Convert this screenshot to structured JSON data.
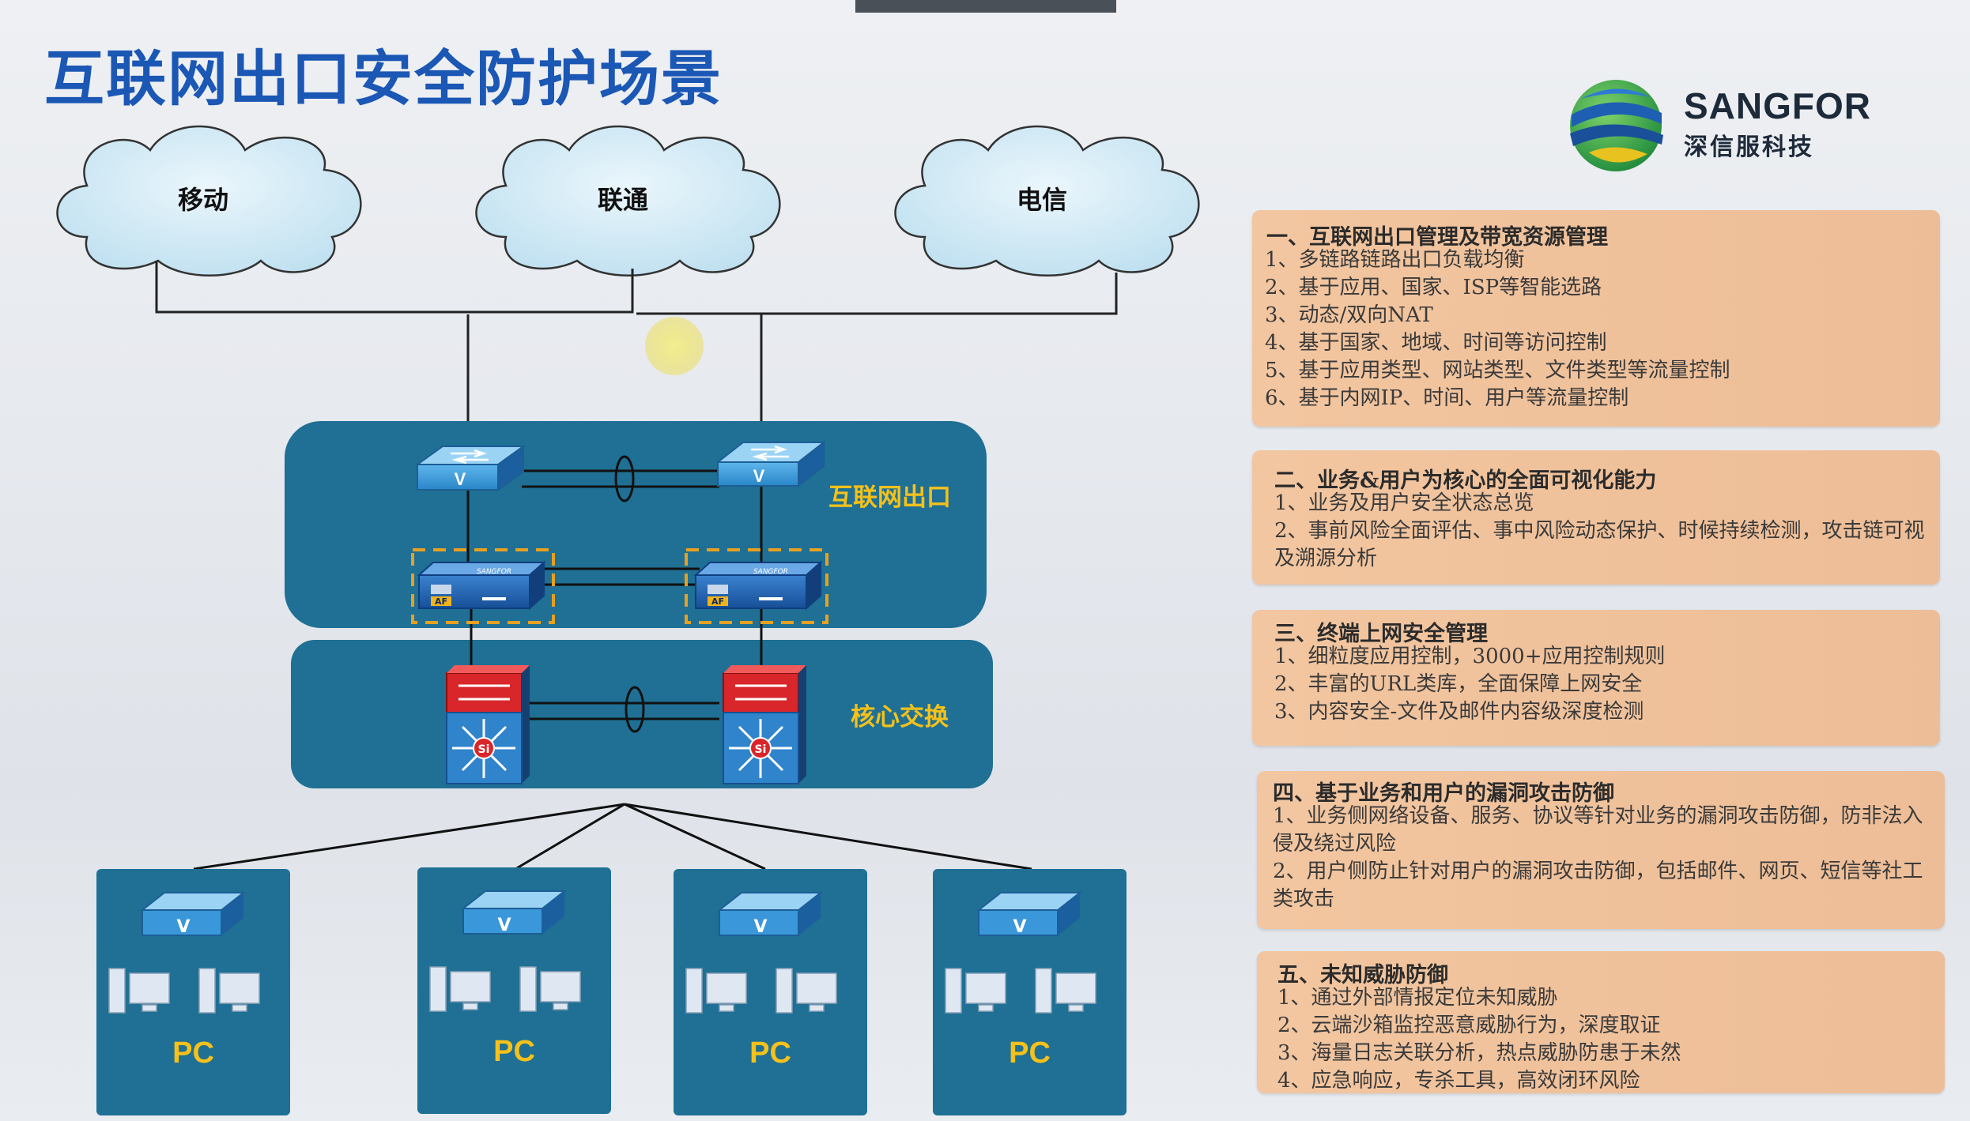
{
  "title": "互联网出口安全防护场景",
  "logo": {
    "brand": "SANGFOR",
    "sub": "深信服科技"
  },
  "clouds": [
    "移动",
    "联通",
    "电信"
  ],
  "zones": {
    "internet_exit": "互联网出口",
    "core_switch": "核心交换"
  },
  "pc_groups": [
    "PC",
    "PC",
    "PC",
    "PC"
  ],
  "devices": {
    "af_label": "AF",
    "af_brand": "SANGFOR",
    "switch_mark": "V",
    "core_mark": "Si"
  },
  "sections": [
    {
      "title": "一、互联网出口管理及带宽资源管理",
      "lines": [
        "1、多链路链路出口负载均衡",
        "2、基于应用、国家、ISP等智能选路",
        "3、动态/双向NAT",
        "4、基于国家、地域、时间等访问控制",
        "5、基于应用类型、网站类型、文件类型等流量控制",
        "6、基于内网IP、时间、用户等流量控制"
      ]
    },
    {
      "title": "二、业务&用户为核心的全面可视化能力",
      "lines": [
        "1、业务及用户安全状态总览",
        "2、事前风险全面评估、事中风险动态保护、时候持续检测，攻击链可视及溯源分析"
      ]
    },
    {
      "title": "三、终端上网安全管理",
      "lines": [
        "1、细粒度应用控制，3000+应用控制规则",
        "2、丰富的URL类库，全面保障上网安全",
        "3、内容安全-文件及邮件内容级深度检测"
      ]
    },
    {
      "title": "四、基于业务和用户的漏洞攻击防御",
      "lines": [
        "1、业务侧网络设备、服务、协议等针对业务的漏洞攻击防御，防非法入侵及绕过风险",
        "2、用户侧防止针对用户的漏洞攻击防御，包括邮件、网页、短信等社工类攻击"
      ]
    },
    {
      "title": "五、未知威胁防御",
      "lines": [
        "1、通过外部情报定位未知威胁",
        "2、云端沙箱监控恶意威胁行为，深度取证",
        "3、海量日志关联分析，热点威胁防患于未然",
        "4、应急响应，专杀工具，高效闭环风险"
      ]
    }
  ],
  "colors": {
    "title": "#1b57b4",
    "panel": "#1f7094",
    "accent": "#f5c11a",
    "info_bg": "#f0c39e"
  }
}
